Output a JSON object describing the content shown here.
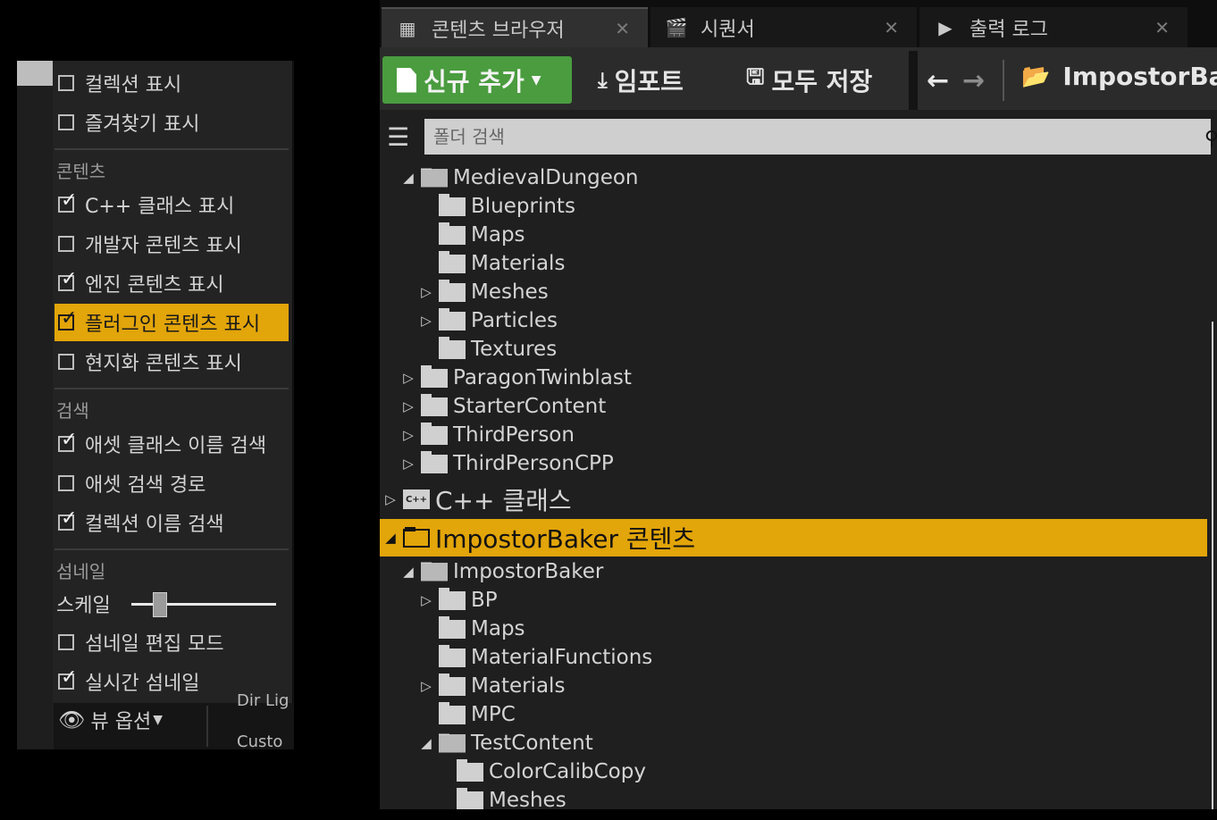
{
  "view_options_menu": {
    "items": [
      {
        "label": "컬렉션 표시",
        "checked": false
      },
      {
        "label": "즐겨찾기 표시",
        "checked": false
      }
    ],
    "sections": [
      {
        "title": "콘텐츠",
        "items": [
          {
            "label": "C++ 클래스 표시",
            "checked": true
          },
          {
            "label": "개발자 콘텐츠 표시",
            "checked": false
          },
          {
            "label": "엔진 콘텐츠 표시",
            "checked": true
          },
          {
            "label": "플러그인 콘텐츠 표시",
            "checked": true,
            "highlighted": true
          },
          {
            "label": "현지화 콘텐츠 표시",
            "checked": false
          }
        ]
      },
      {
        "title": "검색",
        "items": [
          {
            "label": "애셋 클래스 이름 검색",
            "checked": true
          },
          {
            "label": "애셋 검색 경로",
            "checked": false
          },
          {
            "label": "컬렉션 이름 검색",
            "checked": true
          }
        ]
      },
      {
        "title": "섬네일",
        "scale_label": "스케일",
        "scale_value": 0.2,
        "items": [
          {
            "label": "섬네일 편집 모드",
            "checked": false
          },
          {
            "label": "실시간 섬네일",
            "checked": true
          }
        ]
      }
    ],
    "button_label": "뷰 옵션",
    "partial_texts": [
      "Dir Lig",
      "Custo"
    ]
  },
  "content_browser": {
    "tabs": [
      {
        "label": "콘텐츠 브라우저",
        "icon": "grid-icon",
        "active": true
      },
      {
        "label": "시퀀서",
        "icon": "clapper-icon",
        "active": false
      },
      {
        "label": "출력 로그",
        "icon": "terminal-icon",
        "active": false
      }
    ],
    "toolbar": {
      "new_label": "신규 추가",
      "import_label": "임포트",
      "save_all_label": "모두 저장",
      "path_root": "ImpostorBak"
    },
    "search": {
      "placeholder": "폴더 검색"
    },
    "tree": [
      {
        "label": "MedievalDungeon",
        "level": 1,
        "arrow": "open",
        "folder_open": true
      },
      {
        "label": "Blueprints",
        "level": 2,
        "arrow": "none"
      },
      {
        "label": "Maps",
        "level": 2,
        "arrow": "none"
      },
      {
        "label": "Materials",
        "level": 2,
        "arrow": "none"
      },
      {
        "label": "Meshes",
        "level": 2,
        "arrow": "closed"
      },
      {
        "label": "Particles",
        "level": 2,
        "arrow": "closed"
      },
      {
        "label": "Textures",
        "level": 2,
        "arrow": "none"
      },
      {
        "label": "ParagonTwinblast",
        "level": 1,
        "arrow": "closed"
      },
      {
        "label": "StarterContent",
        "level": 1,
        "arrow": "closed"
      },
      {
        "label": "ThirdPerson",
        "level": 1,
        "arrow": "closed"
      },
      {
        "label": "ThirdPersonCPP",
        "level": 1,
        "arrow": "closed"
      },
      {
        "label": "C++ 클래스",
        "level": 0,
        "arrow": "closed",
        "root": true,
        "cpp": true
      },
      {
        "label": "ImpostorBaker 콘텐츠",
        "level": 0,
        "arrow": "open",
        "root": true,
        "highlighted": true,
        "folder_open": true
      },
      {
        "label": "ImpostorBaker",
        "level": 1,
        "arrow": "open",
        "folder_open": true
      },
      {
        "label": "BP",
        "level": 2,
        "arrow": "closed"
      },
      {
        "label": "Maps",
        "level": 2,
        "arrow": "none"
      },
      {
        "label": "MaterialFunctions",
        "level": 2,
        "arrow": "none"
      },
      {
        "label": "Materials",
        "level": 2,
        "arrow": "closed"
      },
      {
        "label": "MPC",
        "level": 2,
        "arrow": "none"
      },
      {
        "label": "TestContent",
        "level": 2,
        "arrow": "open",
        "folder_open": true
      },
      {
        "label": "ColorCalibCopy",
        "level": 3,
        "arrow": "none"
      },
      {
        "label": "Meshes",
        "level": 3,
        "arrow": "none"
      }
    ]
  }
}
